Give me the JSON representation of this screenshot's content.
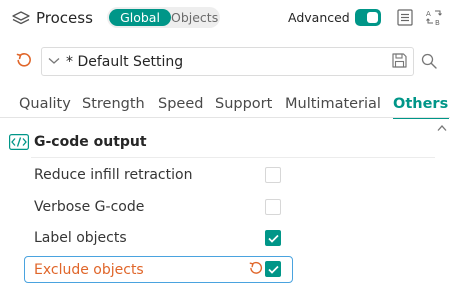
{
  "header": {
    "icon": "layers-icon",
    "title": "Process",
    "mode_global": "Global",
    "mode_objects": "Objects",
    "advanced_label": "Advanced",
    "advanced_enabled": true,
    "list_icon": "list-icon",
    "compare_icon": "compare-icon"
  },
  "preset": {
    "reset_icon": "reset-icon",
    "chevron_icon": "chevron-down-icon",
    "value": "* Default Setting",
    "save_icon": "save-icon",
    "search_icon": "search-icon"
  },
  "tabs": [
    {
      "label": "Quality",
      "active": false
    },
    {
      "label": "Strength",
      "active": false
    },
    {
      "label": "Speed",
      "active": false
    },
    {
      "label": "Support",
      "active": false
    },
    {
      "label": "Multimaterial",
      "active": false
    },
    {
      "label": "Others",
      "active": true
    }
  ],
  "section": {
    "icon": "gcode-icon",
    "title": "G-code output",
    "options": [
      {
        "label": "Reduce infill retraction",
        "checked": false,
        "modified": false
      },
      {
        "label": "Verbose G-code",
        "checked": false,
        "modified": false
      },
      {
        "label": "Label objects",
        "checked": true,
        "modified": false
      },
      {
        "label": "Exclude objects",
        "checked": true,
        "modified": true
      }
    ]
  },
  "colors": {
    "accent": "#009688",
    "modified": "#e0662a",
    "highlight_border": "#4aa3df"
  }
}
